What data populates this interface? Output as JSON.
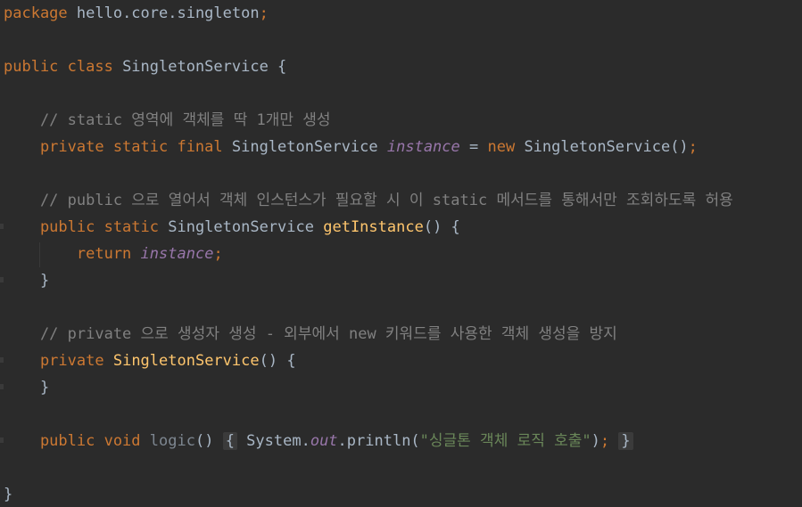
{
  "editor": {
    "lines": [
      [
        {
          "c": "kw",
          "t": "package"
        },
        {
          "c": "plain",
          "t": " hello.core.singleton"
        },
        {
          "c": "kw",
          "t": ";"
        }
      ],
      [],
      [
        {
          "c": "kw",
          "t": "public class"
        },
        {
          "c": "plain",
          "t": " SingletonService {"
        }
      ],
      [],
      [
        {
          "c": "comment",
          "t": "    // static 영역에 객체를 딱 1개만 생성"
        }
      ],
      [
        {
          "c": "kw",
          "t": "    private static final"
        },
        {
          "c": "plain",
          "t": " SingletonService "
        },
        {
          "c": "field",
          "t": "instance"
        },
        {
          "c": "plain",
          "t": " = "
        },
        {
          "c": "kw",
          "t": "new"
        },
        {
          "c": "plain",
          "t": " SingletonService()"
        },
        {
          "c": "kw",
          "t": ";"
        }
      ],
      [],
      [
        {
          "c": "comment",
          "t": "    // public 으로 열어서 객체 인스턴스가 필요할 시 이 static 메서드를 통해서만 조회하도록 허용"
        }
      ],
      [
        {
          "c": "kw",
          "t": "    public static"
        },
        {
          "c": "plain",
          "t": " SingletonService "
        },
        {
          "c": "fn",
          "t": "getInstance"
        },
        {
          "c": "plain",
          "t": "() {"
        }
      ],
      [
        {
          "c": "kw",
          "t": "        return"
        },
        {
          "c": "plain",
          "t": " "
        },
        {
          "c": "field",
          "t": "instance"
        },
        {
          "c": "kw",
          "t": ";"
        }
      ],
      [
        {
          "c": "plain",
          "t": "    }"
        }
      ],
      [],
      [
        {
          "c": "comment",
          "t": "    // private 으로 생성자 생성 - 외부에서 new 키워드를 사용한 객체 생성을 방지"
        }
      ],
      [
        {
          "c": "kw",
          "t": "    private"
        },
        {
          "c": "plain",
          "t": " "
        },
        {
          "c": "fn",
          "t": "SingletonService"
        },
        {
          "c": "plain",
          "t": "() {"
        }
      ],
      [
        {
          "c": "plain",
          "t": "    }"
        }
      ],
      [],
      [
        {
          "c": "kw",
          "t": "    public void"
        },
        {
          "c": "plain",
          "t": " "
        },
        {
          "c": "unused",
          "t": "logic"
        },
        {
          "c": "plain",
          "t": "() "
        },
        {
          "c": "plain fold",
          "t": "{"
        },
        {
          "c": "plain",
          "t": " System."
        },
        {
          "c": "field",
          "t": "out"
        },
        {
          "c": "plain",
          "t": ".println("
        },
        {
          "c": "str",
          "t": "\"싱글톤 객체 로직 호출\""
        },
        {
          "c": "plain",
          "t": ")"
        },
        {
          "c": "kw",
          "t": ";"
        },
        {
          "c": "plain",
          "t": " "
        },
        {
          "c": "plain fold",
          "t": "}"
        }
      ],
      [],
      [
        {
          "c": "plain",
          "t": "}"
        }
      ]
    ]
  }
}
